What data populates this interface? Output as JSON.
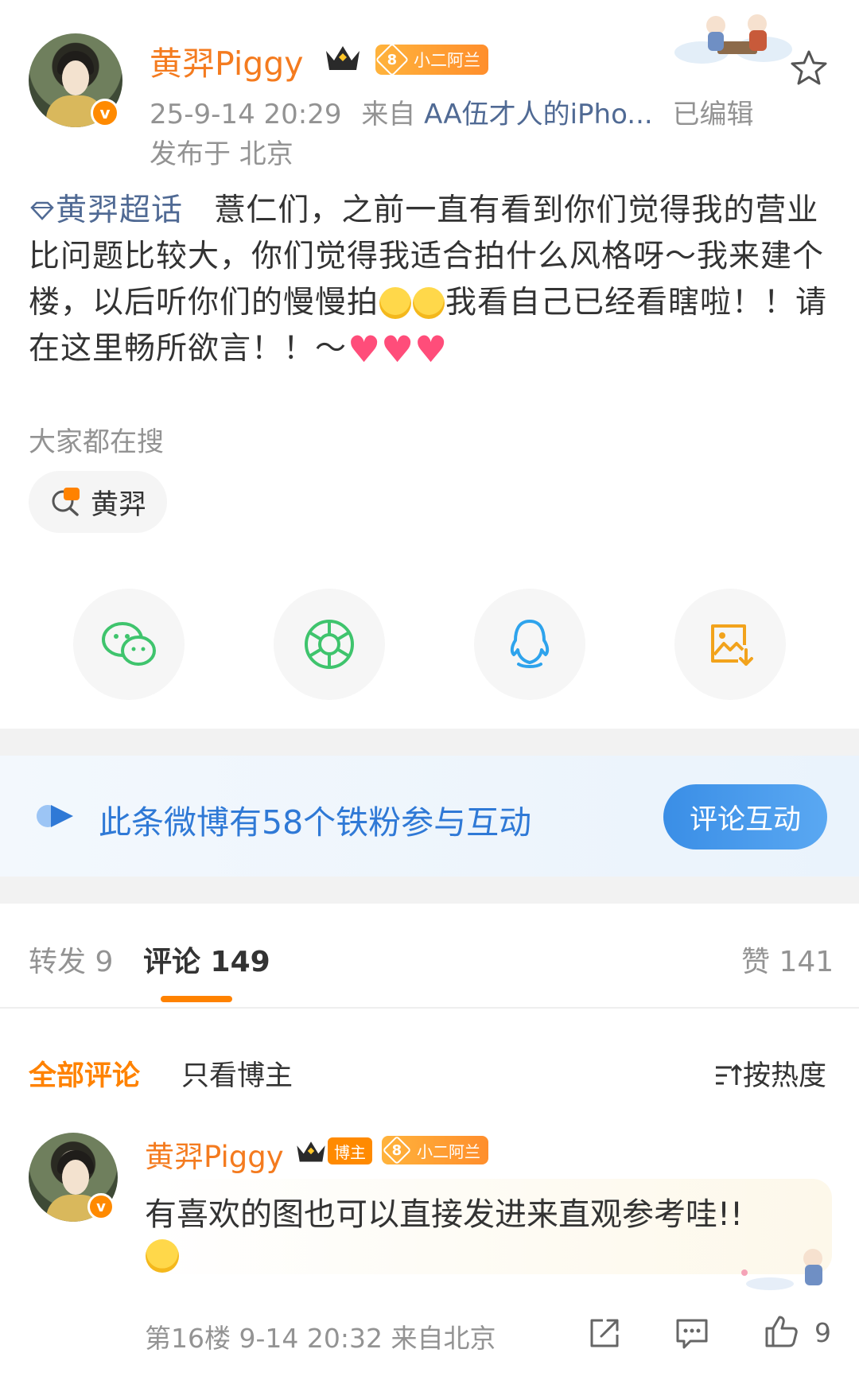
{
  "post": {
    "author": "黄羿Piggy",
    "fan_badge_level": "8",
    "fan_badge_name": "小二阿兰",
    "verified_mark": "v",
    "time": "25-9-14 20:29",
    "source_prefix": "来自",
    "source": "AA伍才人的iPho...",
    "edited": "已编辑",
    "location": "发布于 北京",
    "topic": "黄羿超话",
    "text_1": "薏仁们，之前一直有看到你们觉得我的营业比问题比较大，你们觉得我适合拍什么风格呀～我来建个楼，以后听你们的慢慢拍",
    "text_2": "我看自己已经看瞎啦！！请在这里畅所欲言！！～"
  },
  "search": {
    "label": "大家都在搜",
    "hot_chip": "黄羿"
  },
  "share": {
    "items": [
      {
        "name": "wechat-icon",
        "color": "#3fc46d"
      },
      {
        "name": "moments-icon",
        "color": "#3fc46d"
      },
      {
        "name": "qq-icon",
        "color": "#2ea3ec"
      },
      {
        "name": "save-image-icon",
        "color": "#f2a31c"
      }
    ]
  },
  "fans_banner": {
    "text": "此条微博有58个铁粉参与互动",
    "button": "评论互动"
  },
  "tabs": {
    "repost": "转发 9",
    "comments": "评论 149",
    "likes": "赞 141"
  },
  "comment_filter": {
    "all": "全部评论",
    "blogger_only": "只看博主",
    "sort": "按热度"
  },
  "comments": [
    {
      "author": "黄羿Piggy",
      "role_tag": "博主",
      "fan_badge_level": "8",
      "fan_badge_name": "小二阿兰",
      "text": "有喜欢的图也可以直接发进来直观参考哇!!",
      "floor": "第16楼",
      "time": "9-14 20:32",
      "location": "来自北京",
      "likes": "9"
    }
  ],
  "colors": {
    "brand_orange": "#ff8200",
    "name_orange": "#f47b1f",
    "link_blue": "#506a94",
    "banner_blue": "#2f79d6"
  }
}
